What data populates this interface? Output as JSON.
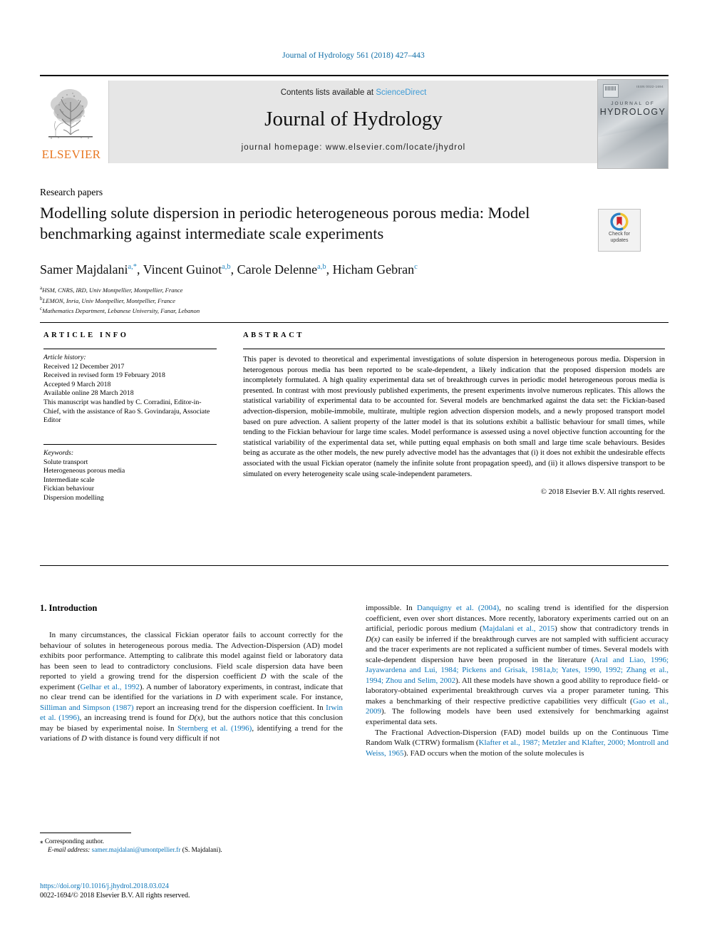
{
  "running_head": "Journal of Hydrology 561 (2018) 427–443",
  "masthead": {
    "contents_prefix": "Contents lists available at ",
    "sciencedirect": "ScienceDirect",
    "journal_title": "Journal of Hydrology",
    "homepage": "journal homepage: www.elsevier.com/locate/jhydrol",
    "publisher": "ELSEVIER",
    "cover": {
      "line1": "JOURNAL OF",
      "line2": "HYDROLOGY",
      "issn": "ISSN 0022-1694"
    }
  },
  "article": {
    "section_label": "Research papers",
    "title": "Modelling solute dispersion in periodic heterogeneous porous media: Model benchmarking against intermediate scale experiments",
    "crossmark": {
      "line1": "Check for",
      "line2": "updates"
    },
    "authors": [
      {
        "name": "Samer Majdalani",
        "marks": "a,*"
      },
      {
        "name": "Vincent Guinot",
        "marks": "a,b"
      },
      {
        "name": "Carole Delenne",
        "marks": "a,b"
      },
      {
        "name": "Hicham Gebran",
        "marks": "c"
      }
    ],
    "affiliations": [
      {
        "mark": "a",
        "text": "HSM, CNRS, IRD, Univ Montpellier, Montpellier, France"
      },
      {
        "mark": "b",
        "text": "LEMON, Inria, Univ Montpellier, Montpellier, France"
      },
      {
        "mark": "c",
        "text": "Mathematics Department, Lebanese University, Fanar, Lebanon"
      }
    ]
  },
  "info": {
    "article_info_heading": "ARTICLE INFO",
    "abstract_heading": "ABSTRACT",
    "history_label": "Article history:",
    "history_lines": [
      "Received 12 December 2017",
      "Received in revised form 19 February 2018",
      "Accepted 9 March 2018",
      "Available online 28 March 2018",
      "This manuscript was handled by C. Corradini, Editor-in-Chief, with the assistance of Rao S. Govindaraju, Associate Editor"
    ],
    "keywords_label": "Keywords:",
    "keywords": [
      "Solute transport",
      "Heterogeneous porous media",
      "Intermediate scale",
      "Fickian behaviour",
      "Dispersion modelling"
    ]
  },
  "abstract": {
    "text": "This paper is devoted to theoretical and experimental investigations of solute dispersion in heterogeneous porous media. Dispersion in heterogenous porous media has been reported to be scale-dependent, a likely indication that the proposed dispersion models are incompletely formulated. A high quality experimental data set of breakthrough curves in periodic model heterogeneous porous media is presented. In contrast with most previously published experiments, the present experiments involve numerous replicates. This allows the statistical variability of experimental data to be accounted for. Several models are benchmarked against the data set: the Fickian-based advection-dispersion, mobile-immobile, multirate, multiple region advection dispersion models, and a newly proposed transport model based on pure advection. A salient property of the latter model is that its solutions exhibit a ballistic behaviour for small times, while tending to the Fickian behaviour for large time scales. Model performance is assessed using a novel objective function accounting for the statistical variability of the experimental data set, while putting equal emphasis on both small and large time scale behaviours. Besides being as accurate as the other models, the new purely advective model has the advantages that (i) it does not exhibit the undesirable effects associated with the usual Fickian operator (namely the infinite solute front propagation speed), and (ii) it allows dispersive transport to be simulated on every heterogeneity scale using scale-independent parameters.",
    "copyright": "© 2018 Elsevier B.V. All rights reserved."
  },
  "body": {
    "heading": "1. Introduction",
    "left_col": {
      "p1_a": "In many circumstances, the classical Fickian operator fails to account correctly for the behaviour of solutes in heterogeneous porous media. The Advection-Dispersion (AD) model exhibits poor performance. Attempting to calibrate this model against field or laboratory data has been seen to lead to contradictory conclusions. Field scale dispersion data have been reported to yield a growing trend for the dispersion coefficient ",
      "D_italic": "D",
      "p1_b": " with the scale of the experiment (",
      "cite1": "Gelhar et al., 1992",
      "p1_c": "). A number of laboratory experiments, in contrast, indicate that no clear trend can be identified for the variations in ",
      "p1_d": " with experiment scale. For instance, ",
      "cite2": "Silliman and Simpson (1987)",
      "p1_e": " report an increasing trend for the dispersion coefficient. In ",
      "cite3": "Irwin et al. (1996)",
      "p1_f": ", an increasing trend is found for ",
      "Dx_italic": "D(x)",
      "p1_g": ", but the authors notice that this conclusion may be biased by experimental noise. In ",
      "cite4": "Sternberg et al. (1996)",
      "p1_h": ", identifying a trend for the variations of ",
      "p1_i": " with distance is found very difficult if not"
    },
    "right_col": {
      "p1_a": "impossible. In ",
      "cite1": "Danquigny et al. (2004)",
      "p1_b": ", no scaling trend is identified for the dispersion coefficient, even over short distances. More recently, laboratory experiments carried out on an artificial, periodic porous medium (",
      "cite2": "Majdalani et al., 2015",
      "p1_c": ") show that contradictory trends in ",
      "Dx_italic": "D(x)",
      "p1_d": " can easily be inferred if the breakthrough curves are not sampled with sufficient accuracy and the tracer experiments are not replicated a sufficient number of times. Several models with scale-dependent dispersion have been proposed in the literature (",
      "cite3": "Aral and Liao, 1996; Jayawardena and Lui, 1984; Pickens and Grisak, 1981a,b; Yates, 1990, 1992; Zhang et al., 1994; Zhou and Selim, 2002",
      "p1_e": "). All these models have shown a good ability to reproduce field- or laboratory-obtained experimental breakthrough curves via a proper parameter tuning. This makes a benchmarking of their respective predictive capabilities very difficult (",
      "cite4": "Gao et al., 2009",
      "p1_f": "). The following models have been used extensively for benchmarking against experimental data sets.",
      "p2_a": "The Fractional Advection-Dispersion (FAD) model builds up on the Continuous Time Random Walk (CTRW) formalism (",
      "cite5": "Klafter et al., 1987; Metzler and Klafter, 2000; Montroll and Weiss, 1965",
      "p2_b": "). FAD occurs when the motion of the solute molecules is"
    }
  },
  "footer": {
    "corresponding_star": "⁎",
    "corresponding_label": "Corresponding author.",
    "email_label": "E-mail address:",
    "email": "samer.majdalani@umontpellier.fr",
    "email_owner": "(S. Majdalani).",
    "doi": "https://doi.org/10.1016/j.jhydrol.2018.03.024",
    "issn_line": "0022-1694/© 2018 Elsevier B.V. All rights reserved."
  },
  "colors": {
    "link_blue": "#0b74b8",
    "header_blue": "#0b6ba5",
    "sciencedirect_blue": "#3d9bd6",
    "elsevier_orange": "#e87722",
    "band_gray": "#e6e6e6"
  }
}
